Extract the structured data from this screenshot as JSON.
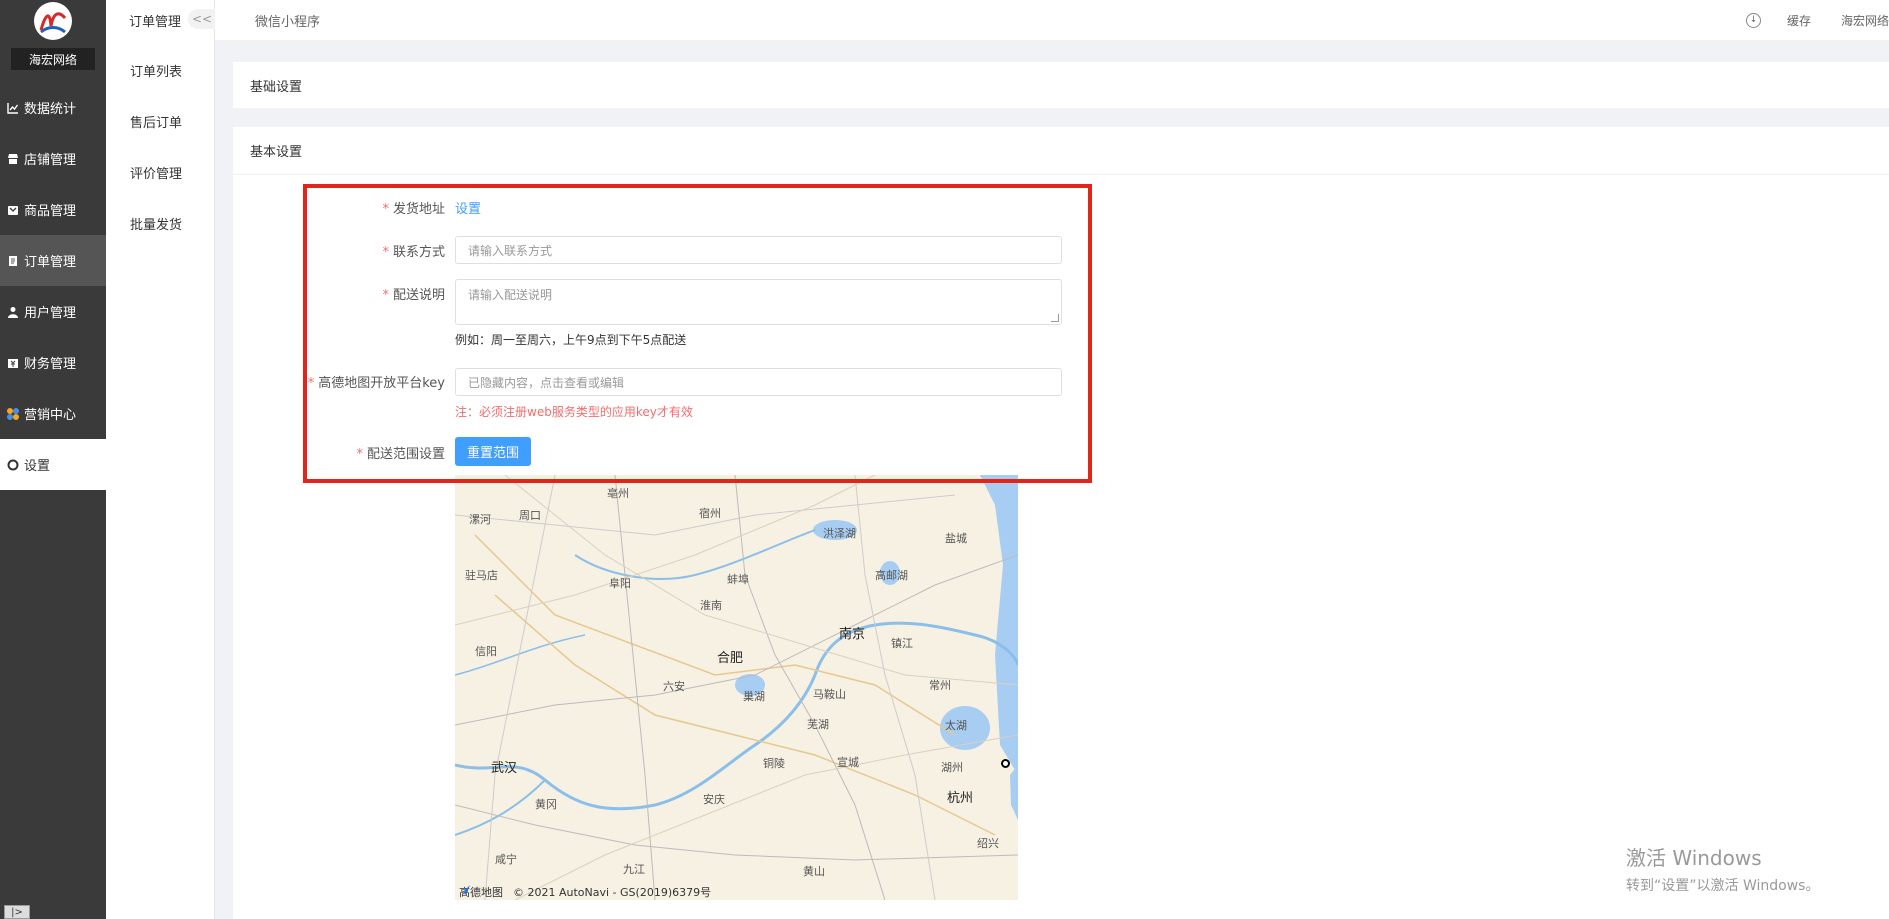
{
  "sidebar": {
    "brand": "海宏网络",
    "items": [
      {
        "label": "数据统计",
        "icon": "line-chart-icon"
      },
      {
        "label": "店铺管理",
        "icon": "store-icon"
      },
      {
        "label": "商品管理",
        "icon": "goods-icon"
      },
      {
        "label": "订单管理",
        "icon": "order-icon"
      },
      {
        "label": "用户管理",
        "icon": "user-icon"
      },
      {
        "label": "财务管理",
        "icon": "finance-icon"
      },
      {
        "label": "营销中心",
        "icon": "marketing-icon"
      },
      {
        "label": "设置",
        "icon": "settings-icon"
      }
    ],
    "collapse_label": "|>"
  },
  "submenu": {
    "title": "订单管理",
    "collapse_label": "<<",
    "items": [
      "订单列表",
      "售后订单",
      "评价管理",
      "批量发货"
    ]
  },
  "header": {
    "tab": "微信小程序",
    "cache": "缓存",
    "user": "海宏网络"
  },
  "panels": {
    "basic": "基础设置",
    "main": "基本设置"
  },
  "form": {
    "address_label": "发货地址",
    "address_link": "设置",
    "contact_label": "联系方式",
    "contact_placeholder": "请输入联系方式",
    "delivery_label": "配送说明",
    "delivery_placeholder": "请输入配送说明",
    "delivery_hint": "例如：周一至周六，上午9点到下午5点配送",
    "amap_label": "高德地图开放平台key",
    "amap_placeholder": "已隐藏内容，点击查看或编辑",
    "amap_warn": "注：必须注册web服务类型的应用key才有效",
    "range_label": "配送范围设置",
    "range_button": "重置范围"
  },
  "map": {
    "cities": [
      {
        "name": "亳州",
        "big": false
      },
      {
        "name": "宿州",
        "big": false
      },
      {
        "name": "漯河",
        "big": false
      },
      {
        "name": "周口",
        "big": false
      },
      {
        "name": "洪泽湖",
        "big": false
      },
      {
        "name": "盐城",
        "big": false
      },
      {
        "name": "驻马店",
        "big": false
      },
      {
        "name": "阜阳",
        "big": false
      },
      {
        "name": "蚌埠",
        "big": false
      },
      {
        "name": "高邮湖",
        "big": false
      },
      {
        "name": "淮南",
        "big": false
      },
      {
        "name": "南京",
        "big": true
      },
      {
        "name": "镇江",
        "big": false
      },
      {
        "name": "信阳",
        "big": false
      },
      {
        "name": "合肥",
        "big": true
      },
      {
        "name": "六安",
        "big": false
      },
      {
        "name": "常州",
        "big": false
      },
      {
        "name": "巢湖",
        "big": false
      },
      {
        "name": "马鞍山",
        "big": false
      },
      {
        "name": "芜湖",
        "big": false
      },
      {
        "name": "太湖",
        "big": false
      },
      {
        "name": "武汉",
        "big": true
      },
      {
        "name": "铜陵",
        "big": false
      },
      {
        "name": "宣城",
        "big": false
      },
      {
        "name": "湖州",
        "big": false
      },
      {
        "name": "黄冈",
        "big": false
      },
      {
        "name": "安庆",
        "big": false
      },
      {
        "name": "杭州",
        "big": true
      },
      {
        "name": "咸宁",
        "big": false
      },
      {
        "name": "九江",
        "big": false
      },
      {
        "name": "黄山",
        "big": false
      },
      {
        "name": "绍兴",
        "big": false
      }
    ],
    "attribution": "© 2021 AutoNavi - GS(2019)6379号",
    "logo_text": "高德地图"
  },
  "watermark": {
    "line1": "激活 Windows",
    "line2": "转到“设置”以激活 Windows。"
  }
}
